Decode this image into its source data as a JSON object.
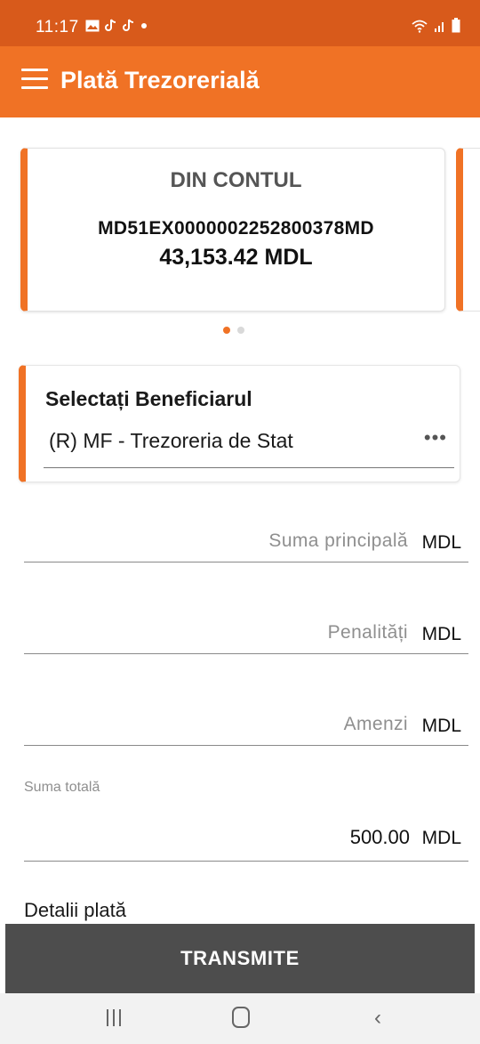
{
  "status_bar": {
    "time": "11:17",
    "notification_icons": [
      "gallery-icon",
      "tiktok-icon",
      "tiktok-icon",
      "dot-icon"
    ],
    "right_icons": [
      "wifi-icon",
      "signal-icon",
      "battery-icon"
    ]
  },
  "app_bar": {
    "title": "Plată Trezorerială",
    "menu_icon": "menu-icon"
  },
  "account_card": {
    "heading": "DIN CONTUL",
    "iban": "MD51EX0000002252800378MD",
    "balance": "43,153.42 MDL"
  },
  "pager": {
    "pages": 2,
    "active_index": 0
  },
  "beneficiary": {
    "title": "Selectați Beneficiarul",
    "value": "(R) MF - Trezoreria de Stat",
    "more_icon": "more-horizontal-icon"
  },
  "fields": {
    "principal": {
      "label": "Suma principală",
      "unit": "MDL",
      "value": ""
    },
    "penalties": {
      "label": "Penalități",
      "unit": "MDL",
      "value": ""
    },
    "fines": {
      "label": "Amenzi",
      "unit": "MDL",
      "value": ""
    }
  },
  "total": {
    "caption": "Suma totală",
    "value": "500.00",
    "unit": "MDL"
  },
  "details": {
    "label": "Detalii plată"
  },
  "submit": {
    "label": "TRANSMITE"
  },
  "nav_bar": {
    "icons": [
      "recent-apps-icon",
      "home-icon",
      "back-icon"
    ]
  },
  "colors": {
    "status_bar": "#d85a1b",
    "accent": "#f07225",
    "submit_bar": "#4d4d4d",
    "nav_bar": "#f2f2f2"
  }
}
